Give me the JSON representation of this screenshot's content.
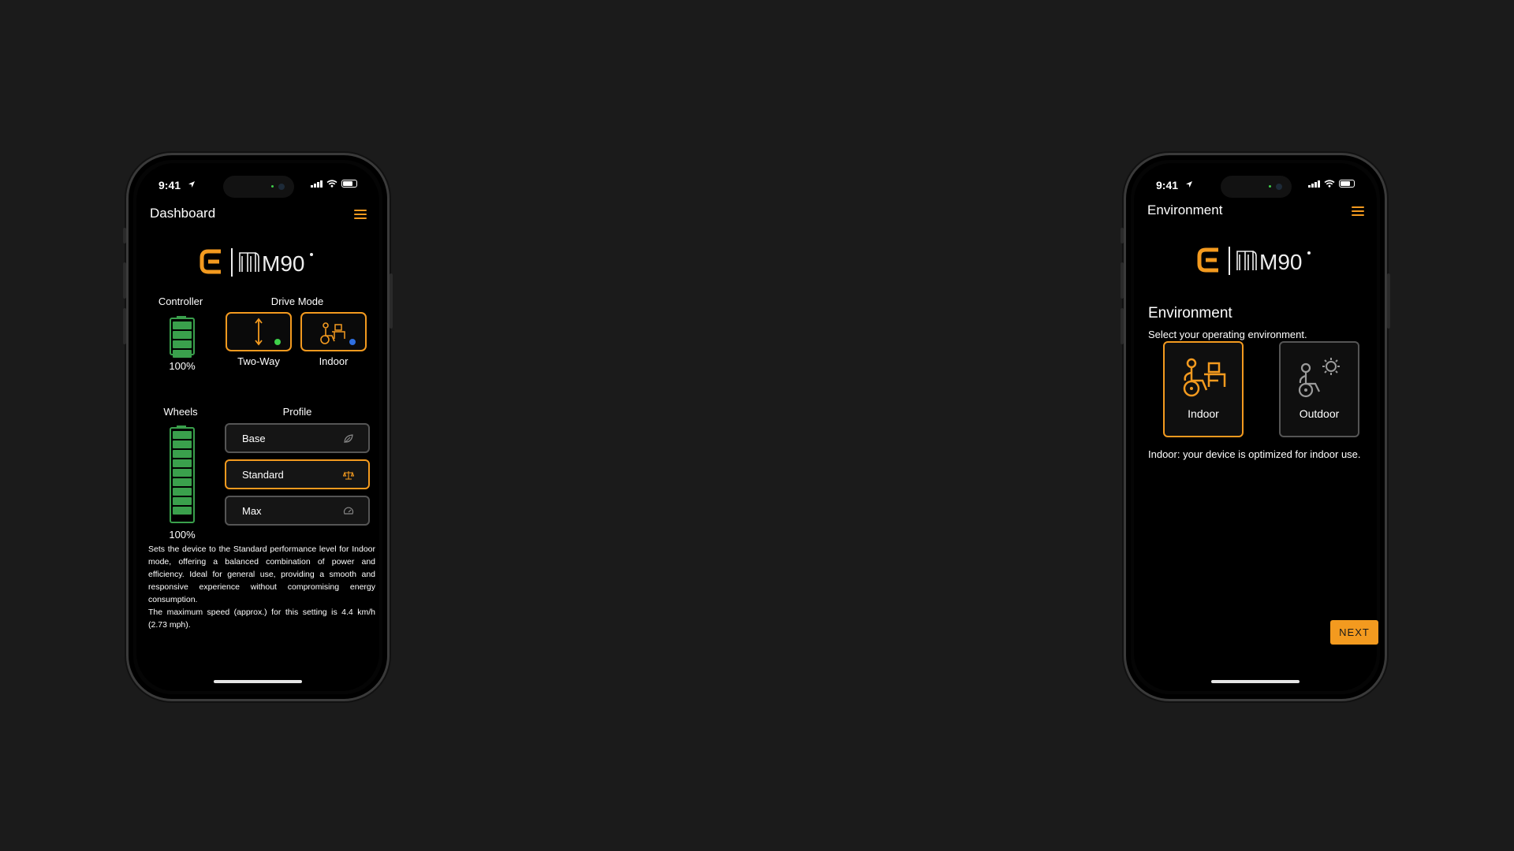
{
  "colors": {
    "accent": "#f39a1f",
    "battery": "#3aa04c",
    "background": "#1b1b1b"
  },
  "left_phone": {
    "status": {
      "time": "9:41"
    },
    "header": {
      "title": "Dashboard",
      "menu_icon": "hamburger-menu-icon"
    },
    "logo_text": "M90",
    "controller": {
      "label": "Controller",
      "level": "100%",
      "fill_fraction": 1.0
    },
    "drive_mode": {
      "label": "Drive Mode",
      "modes": [
        {
          "label": "Two-Way",
          "icon": "two-way-arrow-icon",
          "dot_color": "#3ecf4a"
        },
        {
          "label": "Indoor",
          "icon": "indoor-wheelchair-icon",
          "dot_color": "#2e6fe0"
        }
      ]
    },
    "wheels": {
      "label": "Wheels",
      "level": "100%",
      "fill_fraction": 1.0
    },
    "profile": {
      "label": "Profile",
      "options": [
        {
          "label": "Base",
          "icon": "leaf-icon",
          "selected": false
        },
        {
          "label": "Standard",
          "icon": "balance-scale-icon",
          "selected": true
        },
        {
          "label": "Max",
          "icon": "speedometer-icon",
          "selected": false
        }
      ]
    },
    "description": {
      "line1": "Sets the device to the Standard performance level for Indoor mode, offering a balanced combination of power and efficiency. Ideal for general use, providing a smooth and responsive experience without compromising energy consumption.",
      "line2": "The maximum speed (approx.) for this setting is 4.4 km/h (2.73 mph)."
    }
  },
  "right_phone": {
    "status": {
      "time": "9:41"
    },
    "header": {
      "title": "Environment",
      "menu_icon": "hamburger-menu-icon"
    },
    "logo_text": "M90",
    "section_title": "Environment",
    "subtitle": "Select your operating environment.",
    "options": [
      {
        "label": "Indoor",
        "icon": "indoor-wheelchair-icon",
        "selected": true
      },
      {
        "label": "Outdoor",
        "icon": "outdoor-wheelchair-sun-icon",
        "selected": false
      }
    ],
    "info": "Indoor: your device is optimized for indoor use.",
    "next_label": "NEXT"
  }
}
